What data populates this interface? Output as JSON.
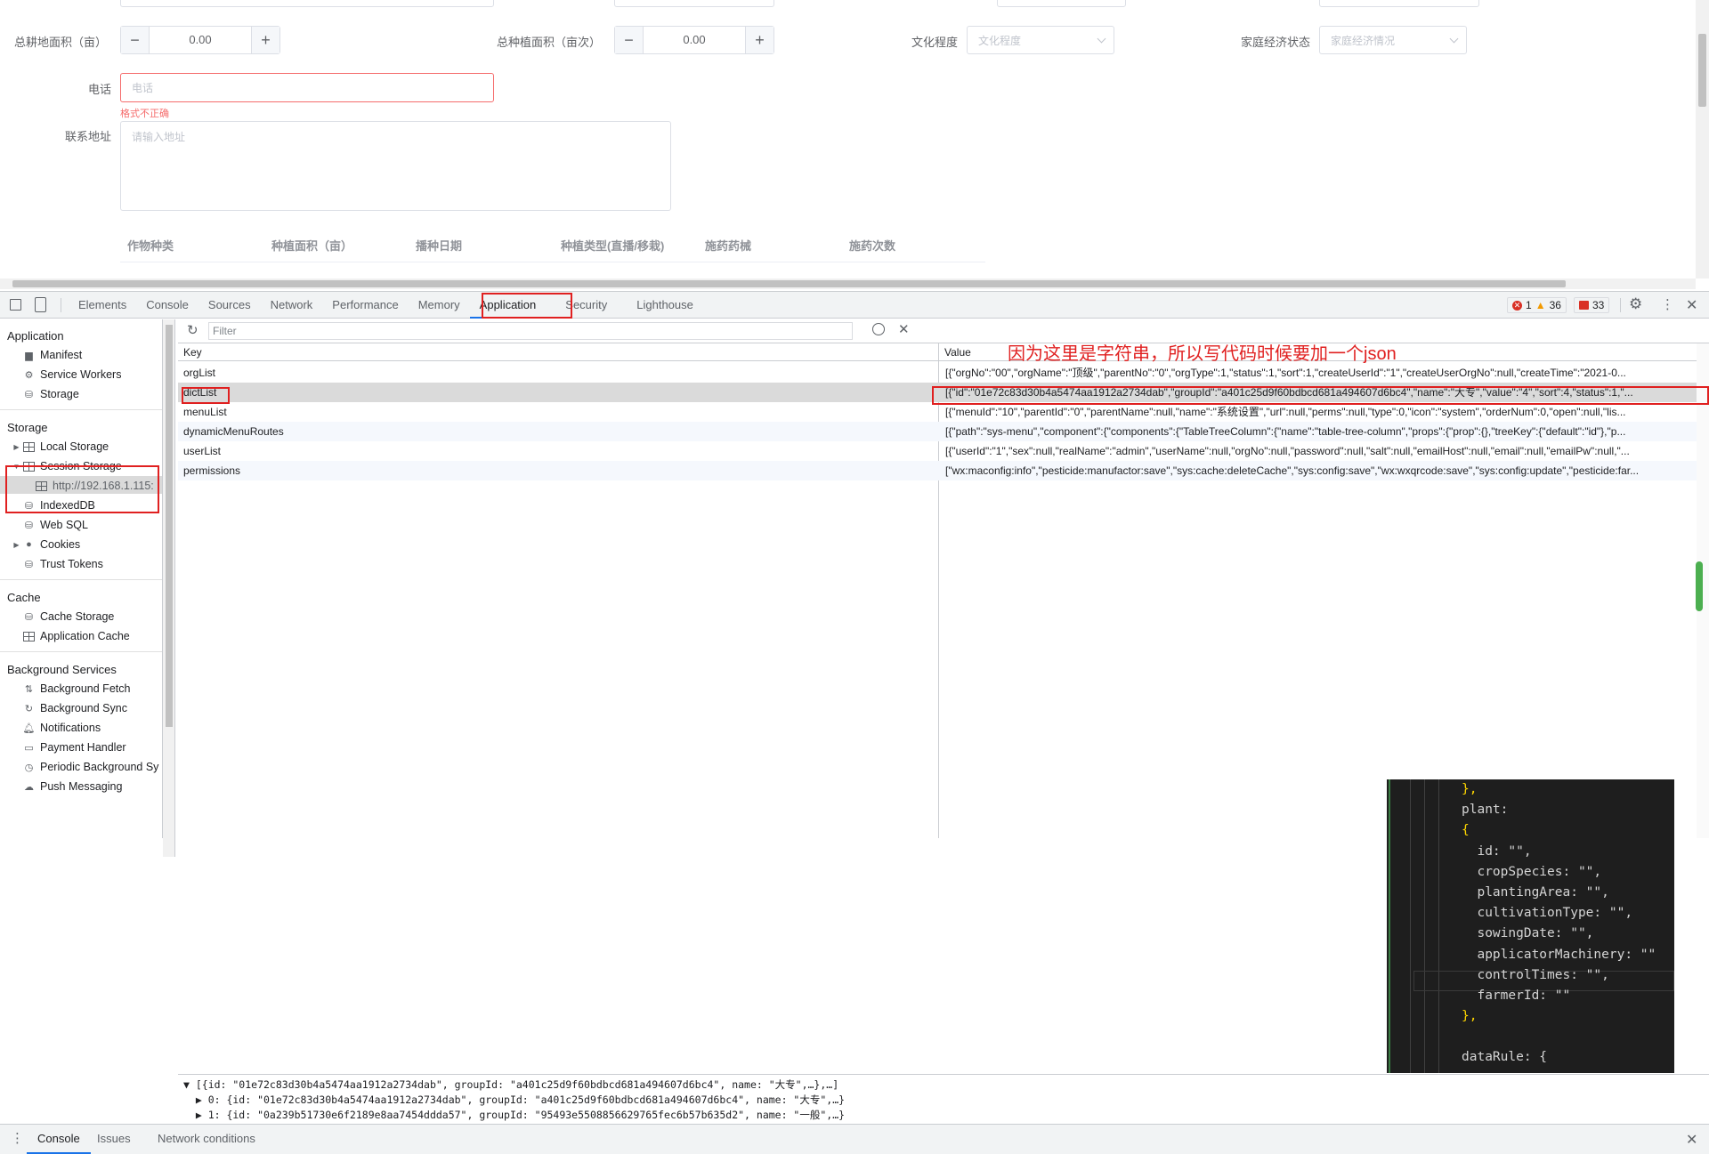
{
  "page": {
    "total_land_label": "总耕地面积（亩）",
    "total_land_value": "0.00",
    "total_plant_label": "总种植面积（亩次）",
    "total_plant_value": "0.00",
    "education_label": "文化程度",
    "education_placeholder": "文化程度",
    "economy_label": "家庭经济状态",
    "economy_placeholder": "家庭经济情况",
    "phone_label": "电话",
    "phone_placeholder": "电话",
    "phone_error": "格式不正确",
    "address_label": "联系地址",
    "address_placeholder": "请输入地址",
    "table_headers": [
      "作物种类",
      "种植面积（亩）",
      "播种日期",
      "种植类型(直播/移栽)",
      "施药药械",
      "施药次数"
    ],
    "minus_symbol": "−",
    "plus_symbol": "+"
  },
  "devtools": {
    "tabs": [
      "Elements",
      "Console",
      "Sources",
      "Network",
      "Performance",
      "Memory",
      "Application",
      "Security",
      "Lighthouse"
    ],
    "active_tab": "Application",
    "errors": "1",
    "warnings": "36",
    "issues": "33",
    "filter_placeholder": "Filter",
    "key_header": "Key",
    "value_header": "Value",
    "annotation": "因为这里是字符串，所以写代码时候要加一个json"
  },
  "sidebar": {
    "application_header": "Application",
    "application_items": [
      "Manifest",
      "Service Workers",
      "Storage"
    ],
    "storage_header": "Storage",
    "storage_items": [
      "Local Storage",
      "Session Storage",
      "http://192.168.1.115:",
      "IndexedDB",
      "Web SQL",
      "Cookies",
      "Trust Tokens"
    ],
    "cache_header": "Cache",
    "cache_items": [
      "Cache Storage",
      "Application Cache"
    ],
    "bg_header": "Background Services",
    "bg_items": [
      "Background Fetch",
      "Background Sync",
      "Notifications",
      "Payment Handler",
      "Periodic Background Sy",
      "Push Messaging"
    ]
  },
  "storage_rows": [
    {
      "key": "orgList",
      "value": "[{\"orgNo\":\"00\",\"orgName\":\"顶级\",\"parentNo\":\"0\",\"orgType\":1,\"status\":1,\"sort\":1,\"createUserId\":\"1\",\"createUserOrgNo\":null,\"createTime\":\"2021-0..."
    },
    {
      "key": "dictList",
      "value": "[{\"id\":\"01e72c83d30b4a5474aa1912a2734dab\",\"groupId\":\"a401c25d9f60bdbcd681a494607d6bc4\",\"name\":\"大专\",\"value\":\"4\",\"sort\":4,\"status\":1,\"..."
    },
    {
      "key": "menuList",
      "value": "[{\"menuId\":\"10\",\"parentId\":\"0\",\"parentName\":null,\"name\":\"系统设置\",\"url\":null,\"perms\":null,\"type\":0,\"icon\":\"system\",\"orderNum\":0,\"open\":null,\"lis..."
    },
    {
      "key": "dynamicMenuRoutes",
      "value": "[{\"path\":\"sys-menu\",\"component\":{\"components\":{\"TableTreeColumn\":{\"name\":\"table-tree-column\",\"props\":{\"prop\":{},\"treeKey\":{\"default\":\"id\"},\"p..."
    },
    {
      "key": "userList",
      "value": "[{\"userId\":\"1\",\"sex\":null,\"realName\":\"admin\",\"userName\":null,\"orgNo\":null,\"password\":null,\"salt\":null,\"emailHost\":null,\"email\":null,\"emailPw\":null,\"..."
    },
    {
      "key": "permissions",
      "value": "[\"wx:maconfig:info\",\"pesticide:manufactor:save\",\"sys:cache:deleteCache\",\"sys:config:save\",\"wx:wxqrcode:save\",\"sys:config:update\",\"pesticide:far..."
    }
  ],
  "code_lines": [
    "},",
    "plant:",
    "{",
    "  id: \"\",",
    "  cropSpecies: \"\",",
    "  plantingArea: \"\",",
    "  cultivationType: \"\",",
    "  sowingDate: \"\",",
    "  applicatorMachinery: \"\"",
    "  controlTimes: \"\",",
    "  farmerId: \"\"",
    "},",
    "",
    "dataRule: {"
  ],
  "console_preview": [
    "▼ [{id: \"01e72c83d30b4a5474aa1912a2734dab\", groupId: \"a401c25d9f60bdbcd681a494607d6bc4\", name: \"大专\",…},…]",
    "  ▶ 0: {id: \"01e72c83d30b4a5474aa1912a2734dab\", groupId: \"a401c25d9f60bdbcd681a494607d6bc4\", name: \"大专\",…}",
    "  ▶ 1: {id: \"0a239b51730e6f2189e8aa7454ddda57\", groupId: \"95493e5508856629765fec6b57b635d2\", name: \"一般\",…}"
  ],
  "drawer_tabs": [
    "Console",
    "Issues",
    "Network conditions"
  ],
  "colors": {
    "accent": "#1a73e8",
    "highlight": "#e02020",
    "error": "#f56c6c",
    "selected_row": "#dadada",
    "code_bg": "#1e1e1e"
  }
}
